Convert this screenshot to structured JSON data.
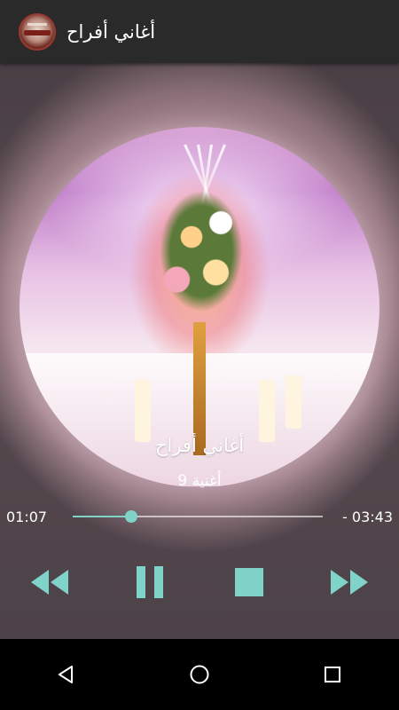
{
  "app_bar": {
    "title": "أغاني أفراح",
    "icon": "app-logo-icon"
  },
  "artwork": {
    "description_icon": "wedding-hall-artwork"
  },
  "track": {
    "title": "أغاني أفراح",
    "subtitle": "أغنية 9"
  },
  "progress": {
    "current_time": "01:07",
    "remaining_time": "- 03:43",
    "fraction": 0.235
  },
  "controls": {
    "rewind_icon": "rewind-icon",
    "pause_icon": "pause-icon",
    "stop_icon": "stop-icon",
    "fast_forward_icon": "fast-forward-icon"
  },
  "nav": {
    "back_icon": "back-icon",
    "home_icon": "home-icon",
    "recents_icon": "recents-icon"
  },
  "colors": {
    "accent": "#7fd3c8",
    "app_bar": "#2a2a2a",
    "nav_bar": "#000000"
  }
}
